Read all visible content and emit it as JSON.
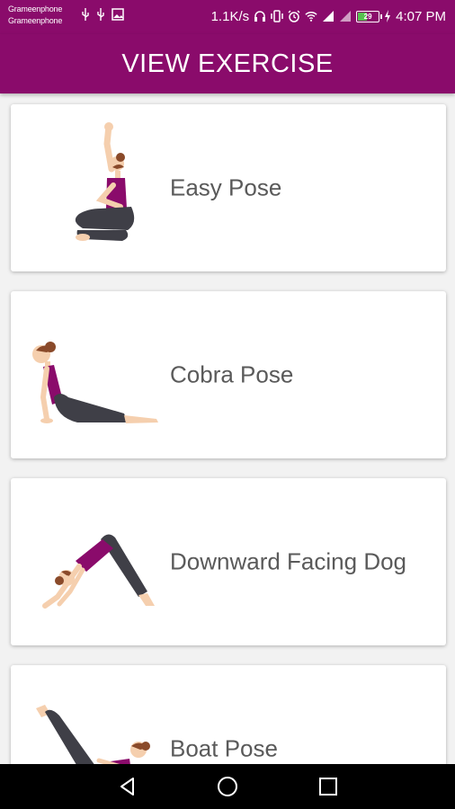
{
  "status_bar": {
    "carrier_1": "Grameenphone",
    "carrier_2": "Grameenphone",
    "net_speed": "1.1K/s",
    "battery_level": "29",
    "time": "4:07 PM",
    "icons": [
      "usb-icon",
      "usb-icon",
      "image-icon",
      "headset-icon",
      "vibrate-icon",
      "alarm-icon",
      "wifi-icon",
      "signal-icon",
      "signal-icon",
      "battery-icon",
      "charging-icon"
    ]
  },
  "app_bar": {
    "title": "VIEW EXERCISE"
  },
  "exercises": [
    {
      "label": "Easy Pose",
      "image": "easy-pose-illustration"
    },
    {
      "label": "Cobra Pose",
      "image": "cobra-pose-illustration"
    },
    {
      "label": "Downward Facing Dog",
      "image": "downward-dog-illustration"
    },
    {
      "label": "Boat Pose",
      "image": "boat-pose-illustration"
    }
  ],
  "nav_bar": {
    "icons": [
      "back-icon",
      "home-icon",
      "recents-icon"
    ]
  },
  "colors": {
    "primary": "#8a0b6b",
    "outfit_top": "#8a0b6b",
    "outfit_pants": "#3f3f47",
    "skin": "#f5cfae",
    "hair": "#8a4a2a"
  }
}
